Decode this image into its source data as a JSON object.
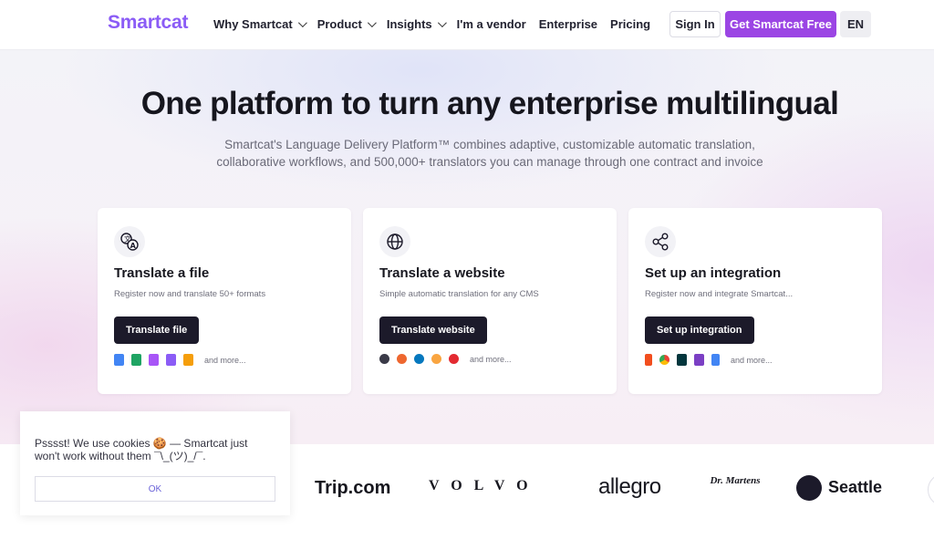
{
  "nav": {
    "logo": "Smartcat",
    "menu": [
      {
        "label": "Why Smartcat",
        "dropdown": true
      },
      {
        "label": "Product",
        "dropdown": true
      },
      {
        "label": "Insights",
        "dropdown": true
      },
      {
        "label": "I'm a vendor",
        "dropdown": false
      },
      {
        "label": "Enterprise",
        "dropdown": false
      },
      {
        "label": "Pricing",
        "dropdown": false
      }
    ],
    "sign_in": "Sign In",
    "get_free": "Get Smartcat Free",
    "lang": "EN"
  },
  "hero": {
    "title": "One platform to turn any enterprise multilingual",
    "subtitle_line1": "Smartcat's Language Delivery Platform™ combines adaptive, customizable automatic translation,",
    "subtitle_line2": "collaborative workflows, and 500,000+ translators you can manage through one contract and invoice"
  },
  "cards": [
    {
      "icon": "translate-icon",
      "title": "Translate a file",
      "desc": "Register now and translate 50+ formats",
      "button": "Translate file",
      "more": "and more...",
      "mini_icons": [
        "docs-icon",
        "video-icon",
        "audio-icon",
        "code-icon",
        "image-icon"
      ]
    },
    {
      "icon": "globe-icon",
      "title": "Translate a website",
      "desc": "Simple automatic translation for any CMS",
      "button": "Translate website",
      "more": "and more...",
      "mini_icons": [
        "wordpress-icon",
        "magento-icon",
        "drupal-icon",
        "joomla-icon",
        "opencart-icon"
      ]
    },
    {
      "icon": "share-icon",
      "title": "Set up an integration",
      "desc": "Register now and integrate Smartcat...",
      "button": "Set up integration",
      "more": "and more...",
      "mini_icons": [
        "figma-icon",
        "chrome-icon",
        "zendesk-icon",
        "visual-studio-icon",
        "google-docs-icon"
      ]
    }
  ],
  "brands": [
    "Trip.com",
    "VOLVO",
    "allegro",
    "Dr. Martens",
    "Seattle"
  ],
  "cookie": {
    "text": "Psssst! We use cookies 🍪 — Smartcat just won't work without them ¯\\_(ツ)_/¯.",
    "ok": "OK"
  },
  "colors": {
    "brand": "#8b5cf6",
    "cta": "#9b45e4",
    "dark_button": "#1c1a2a"
  }
}
